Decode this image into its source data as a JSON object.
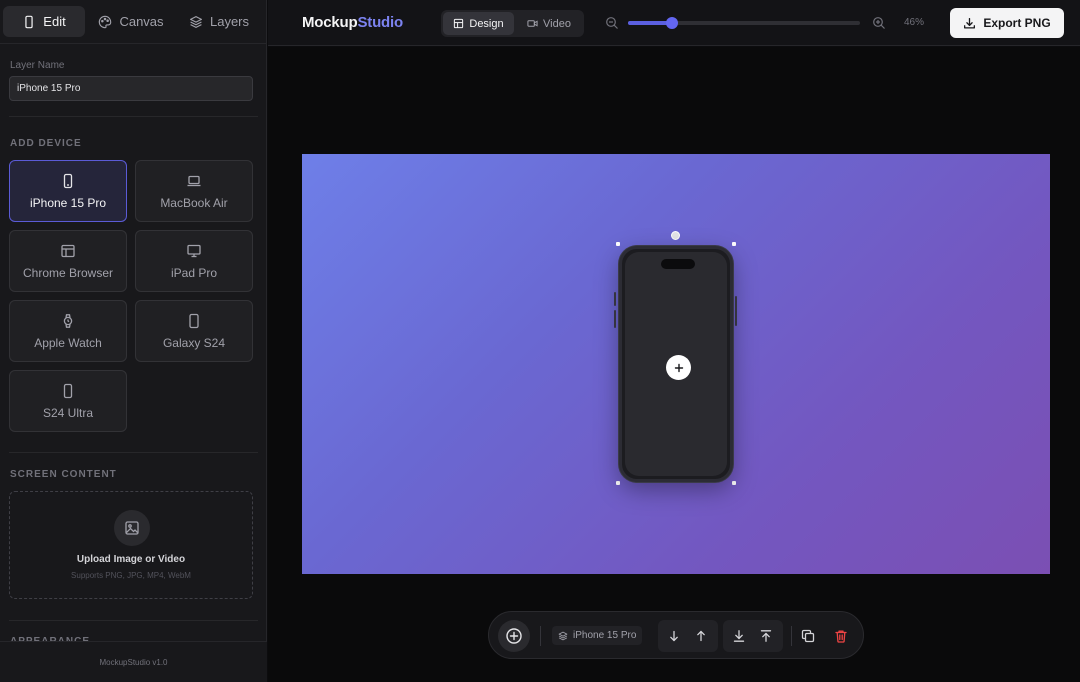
{
  "sidebar": {
    "tabs": [
      {
        "label": "Edit",
        "icon": "phone-icon",
        "active": true
      },
      {
        "label": "Canvas",
        "icon": "palette-icon",
        "active": false
      },
      {
        "label": "Layers",
        "icon": "layers-icon",
        "active": false
      }
    ],
    "layer_name_label": "Layer Name",
    "layer_name_value": "iPhone 15 Pro",
    "add_device_title": "ADD DEVICE",
    "devices": [
      {
        "label": "iPhone 15 Pro",
        "icon": "smartphone-icon",
        "active": true
      },
      {
        "label": "MacBook Air",
        "icon": "laptop-icon",
        "active": false
      },
      {
        "label": "Chrome Browser",
        "icon": "browser-icon",
        "active": false
      },
      {
        "label": "iPad Pro",
        "icon": "monitor-icon",
        "active": false
      },
      {
        "label": "Apple Watch",
        "icon": "watch-icon",
        "active": false
      },
      {
        "label": "Galaxy S24",
        "icon": "tablet-icon",
        "active": false
      },
      {
        "label": "S24 Ultra",
        "icon": "smartphone-icon",
        "active": false
      }
    ],
    "screen_content_title": "SCREEN CONTENT",
    "upload_title": "Upload Image or Video",
    "upload_subtitle": "Supports PNG, JPG, MP4, WebM",
    "appearance_title": "APPEARANCE",
    "footer": "MockupStudio v1.0"
  },
  "topbar": {
    "logo_main": "Mockup",
    "logo_accent": "Studio",
    "modes": [
      {
        "label": "Design",
        "icon": "design-icon",
        "active": true
      },
      {
        "label": "Video",
        "icon": "video-icon",
        "active": false
      }
    ],
    "zoom_percent": 46,
    "zoom_label": "46%",
    "export_label": "Export PNG"
  },
  "colors": {
    "accent": "#6366f1",
    "logo_accent": "#7c83f0",
    "delete": "#ef4444",
    "gradient_start": "#6e7fe8",
    "gradient_end": "#7b4fb3"
  },
  "toolbar": {
    "selected_layer": "iPhone 15 Pro"
  }
}
